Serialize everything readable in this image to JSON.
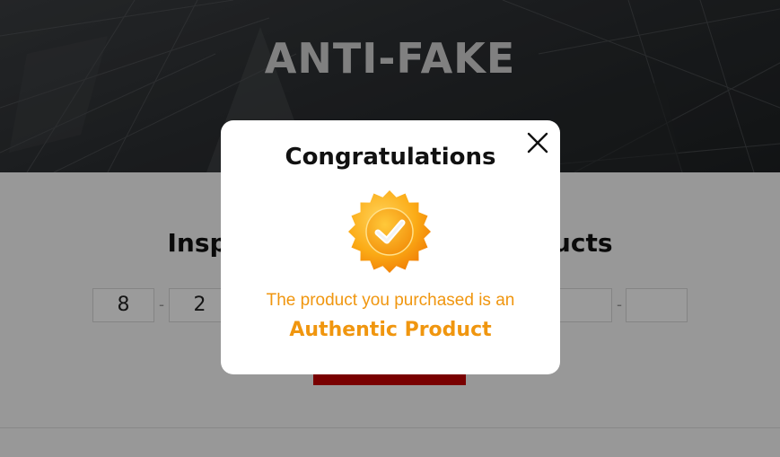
{
  "hero": {
    "title": "ANTI-FAKE"
  },
  "inspection": {
    "title": "Inspection of Genuine Products",
    "code_digits": [
      "8",
      "2",
      "",
      "",
      "",
      "",
      ""
    ]
  },
  "modal": {
    "title": "Congratulations",
    "message": "The product you purchased is an",
    "result": "Authentic Product",
    "accent_color": "#f0960f",
    "badge_icon": "verified-badge-icon",
    "close_icon": "close-icon"
  }
}
